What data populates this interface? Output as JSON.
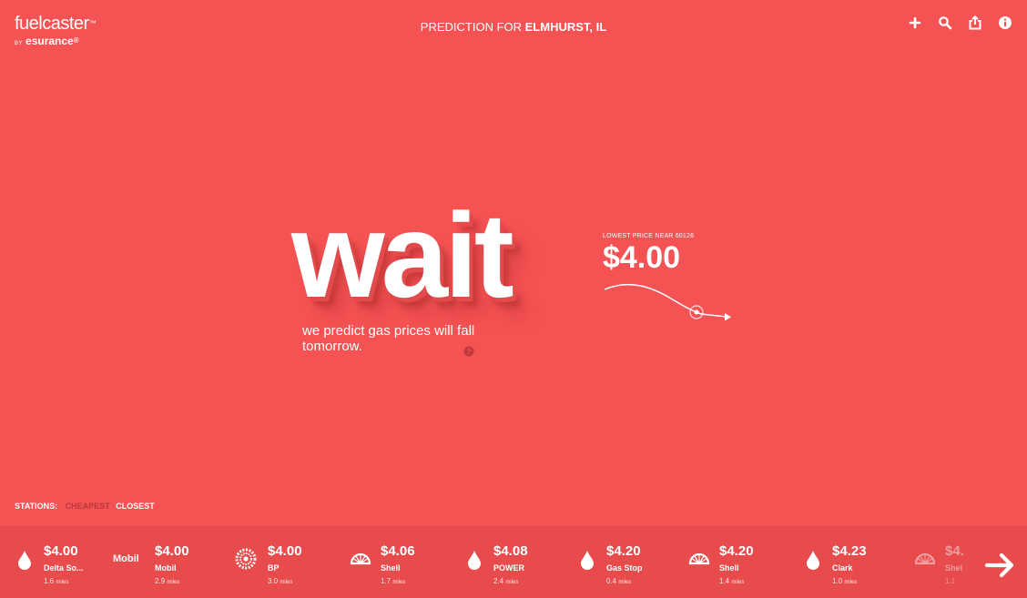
{
  "brand": {
    "name": "fuelcaster",
    "by": "BY",
    "company": "esurance"
  },
  "header": {
    "title_prefix": "PREDICTION FOR",
    "title_location": "ELMHURST, IL",
    "icons": [
      "plus-icon",
      "search-icon",
      "share-icon",
      "info-icon"
    ]
  },
  "prediction": {
    "word": "wait",
    "tagline": "we predict gas prices will fall tomorrow.",
    "lowest_label": "LOWEST PRICE NEAR 60126",
    "lowest_price": "$4.00"
  },
  "filter": {
    "label": "STATIONS:",
    "options": [
      "CHEAPEST",
      "CLOSEST"
    ],
    "active": "CHEAPEST"
  },
  "stations": [
    {
      "price": "$4.00",
      "name": "Delta So...",
      "distance": "1.6",
      "unit": "miles",
      "icon": "drop-icon"
    },
    {
      "price": "$4.00",
      "name": "Mobil",
      "distance": "2.9",
      "unit": "miles",
      "icon": "mobil-logo",
      "logo_text": "Mobil"
    },
    {
      "price": "$4.00",
      "name": "BP",
      "distance": "3.0",
      "unit": "miles",
      "icon": "bp-logo"
    },
    {
      "price": "$4.06",
      "name": "Shell",
      "distance": "1.7",
      "unit": "miles",
      "icon": "shell-logo"
    },
    {
      "price": "$4.08",
      "name": "POWER",
      "distance": "2.4",
      "unit": "miles",
      "icon": "drop-icon"
    },
    {
      "price": "$4.20",
      "name": "Gas Stop",
      "distance": "0.4",
      "unit": "miles",
      "icon": "drop-icon"
    },
    {
      "price": "$4.20",
      "name": "Shell",
      "distance": "1.4",
      "unit": "miles",
      "icon": "shell-logo"
    },
    {
      "price": "$4.23",
      "name": "Clark",
      "distance": "1.0",
      "unit": "miles",
      "icon": "drop-icon"
    },
    {
      "price": "$4.",
      "name": "Shel",
      "distance": "1.1",
      "unit": "",
      "icon": "shell-logo"
    }
  ],
  "colors": {
    "background": "#f55253",
    "bar": "#e74b4c",
    "active_filter": "#b8393b"
  }
}
